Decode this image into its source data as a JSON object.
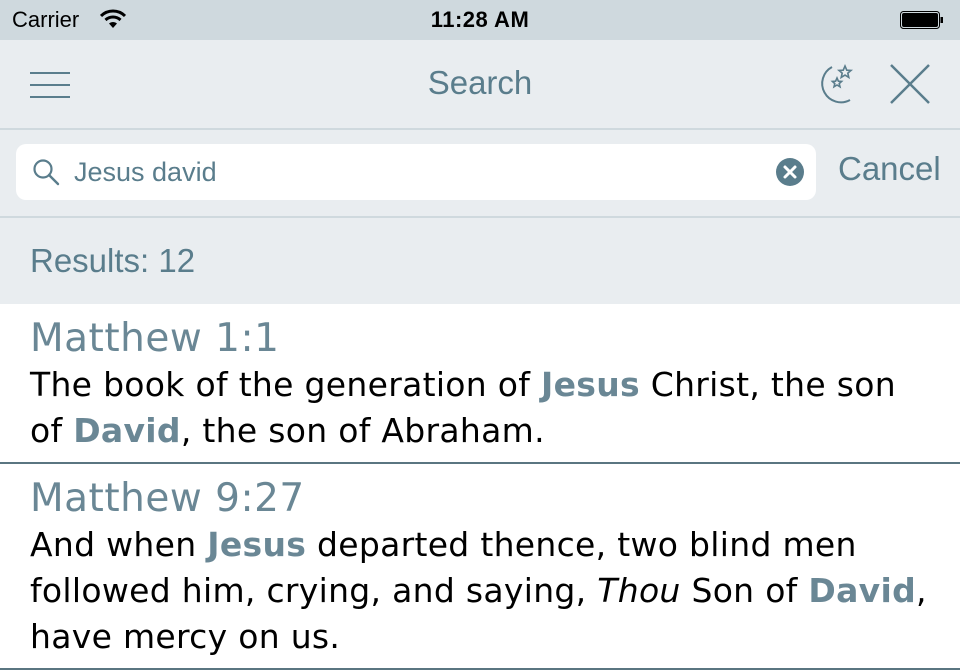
{
  "status_bar": {
    "carrier": "Carrier",
    "time": "11:28 AM",
    "wifi_icon": "wifi-icon",
    "battery_icon": "battery-full-icon"
  },
  "nav": {
    "title": "Search",
    "left_icon": "hamburger-menu-icon",
    "right_icons": [
      "night-mode-moon-stars-icon",
      "close-x-icon"
    ]
  },
  "search": {
    "value": "Jesus david",
    "placeholder": "Search",
    "clear_icon": "clear-circle-x-icon",
    "cancel_label": "Cancel"
  },
  "results": {
    "count_label": "Results: 12",
    "items": [
      {
        "reference": "Matthew 1:1",
        "segments": [
          {
            "text": "The book of the generation of ",
            "style": "normal"
          },
          {
            "text": "Jesus",
            "style": "highlight"
          },
          {
            "text": " Christ, the son of ",
            "style": "normal"
          },
          {
            "text": "David",
            "style": "highlight"
          },
          {
            "text": ", the son of Abraham.",
            "style": "normal"
          }
        ]
      },
      {
        "reference": "Matthew 9:27",
        "segments": [
          {
            "text": "And when ",
            "style": "normal"
          },
          {
            "text": "Jesus",
            "style": "highlight"
          },
          {
            "text": " departed thence, two blind men followed him, crying, and saying, ",
            "style": "normal"
          },
          {
            "text": "Thou",
            "style": "italic"
          },
          {
            "text": " Son of ",
            "style": "normal"
          },
          {
            "text": "David",
            "style": "highlight"
          },
          {
            "text": ", have mercy on us.",
            "style": "normal"
          }
        ]
      }
    ]
  },
  "colors": {
    "accent": "#5a7d8c",
    "highlight": "#6a8795",
    "status_bar_bg": "#cfd9de",
    "nav_bg": "#e9edf0"
  }
}
